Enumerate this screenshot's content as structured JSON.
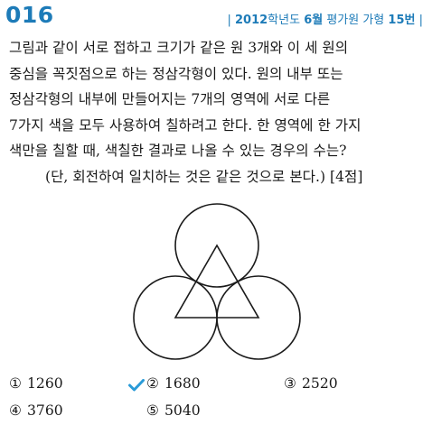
{
  "question": {
    "number": "016",
    "source": {
      "bar_left": "|",
      "year": "2012",
      "middle": "학년도 ",
      "month": "6월",
      "exam": " 평가원 가형 ",
      "qnum": "15번",
      "bar_right": "|"
    },
    "lines": [
      "그림과 같이 서로 접하고 크기가 같은 원 3개와 이 세 원의",
      "중심을 꼭짓점으로 하는 정삼각형이 있다. 원의 내부 또는",
      "정삼각형의 내부에 만들어지는 7개의 영역에 서로 다른",
      "7가지 색을 모두 사용하여 칠하려고 한다. 한 영역에 한 가지",
      "색만을 칠할 때, 색칠한 결과로 나올 수 있는 경우의 수는?"
    ],
    "note": "(단, 회전하여 일치하는 것은 같은 것으로 본다.) [4점]"
  },
  "choices": [
    {
      "marker": "①",
      "value": "1260",
      "selected": false
    },
    {
      "marker": "②",
      "value": "1680",
      "selected": true
    },
    {
      "marker": "③",
      "value": "2520",
      "selected": false
    },
    {
      "marker": "④",
      "value": "3760",
      "selected": false
    },
    {
      "marker": "⑤",
      "value": "5040",
      "selected": false
    }
  ],
  "colors": {
    "accent": "#1d7bb8",
    "check": "#2a9bd8",
    "text": "#1a1a1a"
  },
  "icons": {
    "selected_mark": "checkmark-icon"
  }
}
